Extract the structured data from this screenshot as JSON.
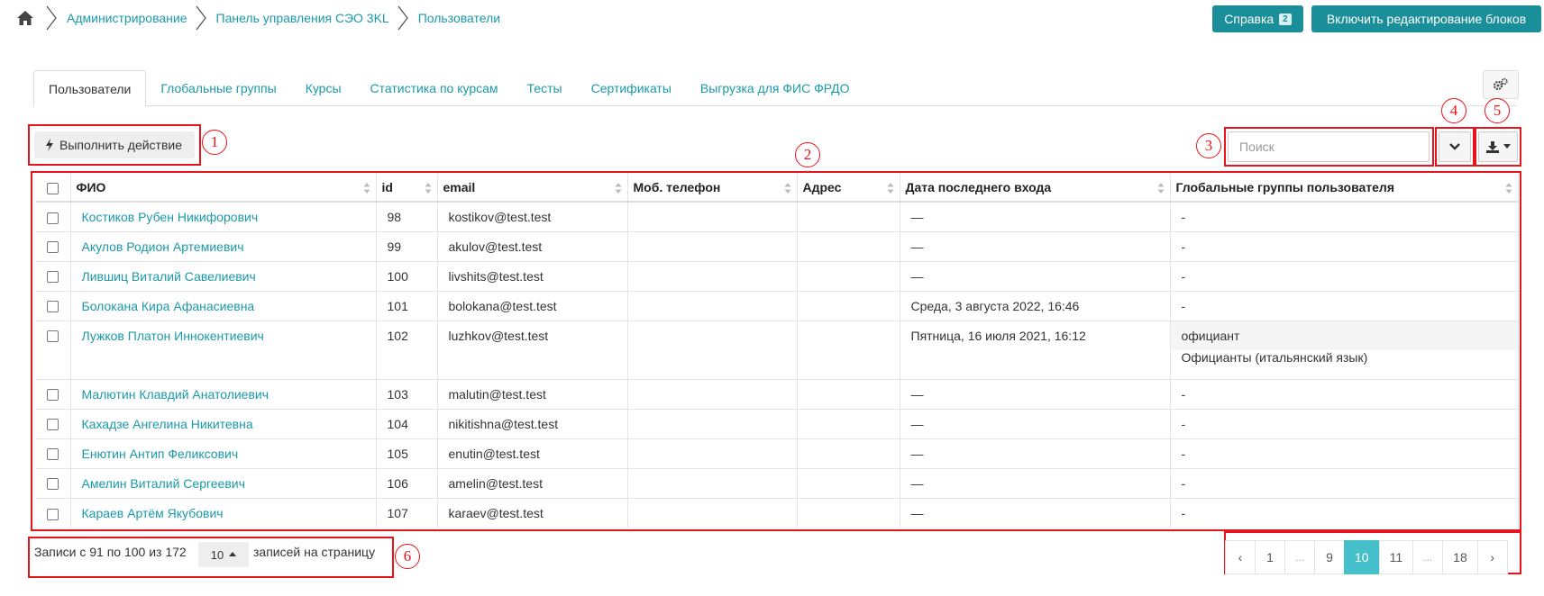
{
  "breadcrumb": {
    "items": [
      "Администрирование",
      "Панель управления СЭО 3KL",
      "Пользователи"
    ]
  },
  "header_buttons": {
    "help_label": "Справка",
    "help_badge": "2",
    "edit_blocks_label": "Включить редактирование блоков"
  },
  "tabs": [
    {
      "label": "Пользователи",
      "active": true
    },
    {
      "label": "Глобальные группы"
    },
    {
      "label": "Курсы"
    },
    {
      "label": "Статистика по курсам"
    },
    {
      "label": "Тесты"
    },
    {
      "label": "Сертификаты"
    },
    {
      "label": "Выгрузка для ФИС ФРДО"
    }
  ],
  "toolbar": {
    "action_label": "Выполнить действие",
    "search_placeholder": "Поиск"
  },
  "markers": [
    "1",
    "2",
    "3",
    "4",
    "5",
    "6"
  ],
  "table": {
    "columns": [
      "ФИО",
      "id",
      "email",
      "Моб. телефон",
      "Адрес",
      "Дата последнего входа",
      "Глобальные группы пользователя"
    ],
    "rows": [
      {
        "name": "Костиков Рубен Никифорович",
        "id": "98",
        "email": "kostikov@test.test",
        "phone": "",
        "address": "",
        "last_login": "—",
        "groups": [
          "-"
        ]
      },
      {
        "name": "Акулов Родион Артемиевич",
        "id": "99",
        "email": "akulov@test.test",
        "phone": "",
        "address": "",
        "last_login": "—",
        "groups": [
          "-"
        ]
      },
      {
        "name": "Лившиц Виталий Савелиевич",
        "id": "100",
        "email": "livshits@test.test",
        "phone": "",
        "address": "",
        "last_login": "—",
        "groups": [
          "-"
        ]
      },
      {
        "name": "Болокана Кира Афанасиевна",
        "id": "101",
        "email": "bolokana@test.test",
        "phone": "",
        "address": "",
        "last_login": "Среда, 3 августа 2022, 16:46",
        "groups": [
          "-"
        ]
      },
      {
        "name": "Лужков Платон Иннокентиевич",
        "id": "102",
        "email": "luzhkov@test.test",
        "phone": "",
        "address": "",
        "last_login": "Пятница, 16 июля 2021, 16:12",
        "groups": [
          "официант",
          "Официанты (итальянский язык)"
        ]
      },
      {
        "name": "Малютин Клавдий Анатолиевич",
        "id": "103",
        "email": "malutin@test.test",
        "phone": "",
        "address": "",
        "last_login": "—",
        "groups": [
          "-"
        ]
      },
      {
        "name": "Кахадзе Ангелина Никитевна",
        "id": "104",
        "email": "nikitishna@test.test",
        "phone": "",
        "address": "",
        "last_login": "—",
        "groups": [
          "-"
        ]
      },
      {
        "name": "Енютин Антип Феликсович",
        "id": "105",
        "email": "enutin@test.test",
        "phone": "",
        "address": "",
        "last_login": "—",
        "groups": [
          "-"
        ]
      },
      {
        "name": "Амелин Виталий Сергеевич",
        "id": "106",
        "email": "amelin@test.test",
        "phone": "",
        "address": "",
        "last_login": "—",
        "groups": [
          "-"
        ]
      },
      {
        "name": "Караев Артём Якубович",
        "id": "107",
        "email": "karaev@test.test",
        "phone": "",
        "address": "",
        "last_login": "—",
        "groups": [
          "-"
        ]
      }
    ]
  },
  "footer": {
    "records_text": "Записи с 91 по 100 из 172",
    "per_page_value": "10",
    "per_page_suffix": "записей на страницу"
  },
  "pagination": {
    "pages": [
      "‹",
      "1",
      "...",
      "9",
      "10",
      "11",
      "...",
      "18",
      "›"
    ],
    "current": "10"
  },
  "colors": {
    "accent": "#1a9aa8",
    "button_bg": "#1a8f99",
    "active_page": "#45bfc9",
    "annotation": "#e8141b"
  }
}
